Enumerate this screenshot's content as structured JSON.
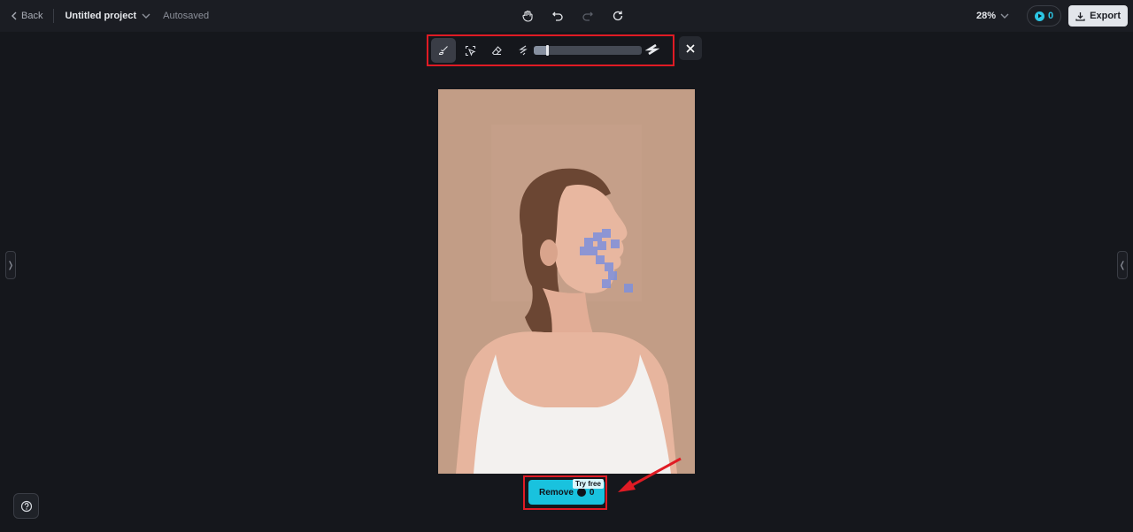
{
  "topbar": {
    "back_label": "Back",
    "project_name": "Untitled project",
    "autosave_status": "Autosaved",
    "zoom_level": "28%",
    "credits": "0",
    "export_label": "Export",
    "icons": [
      "hand-icon",
      "undo-icon",
      "redo-icon",
      "reset-icon"
    ]
  },
  "brush_toolbar": {
    "tools": [
      {
        "name": "brush",
        "active": true
      },
      {
        "name": "smart-select",
        "active": false
      },
      {
        "name": "eraser",
        "active": false
      }
    ],
    "brush_size_percent": 12,
    "close_label": "×"
  },
  "canvas": {
    "image_description": "Woman smiling with eyes closed, white tank top, beige background, blue brush mask over cheek"
  },
  "action": {
    "remove_label": "Remove",
    "remove_cost": "0",
    "badge": "Try free"
  },
  "side": {
    "left_toggle": "❭",
    "right_toggle": "❬"
  },
  "help_icon": "?",
  "colors": {
    "accent": "#19c2de",
    "highlight_box": "#e01b24",
    "background": "#15171c"
  }
}
